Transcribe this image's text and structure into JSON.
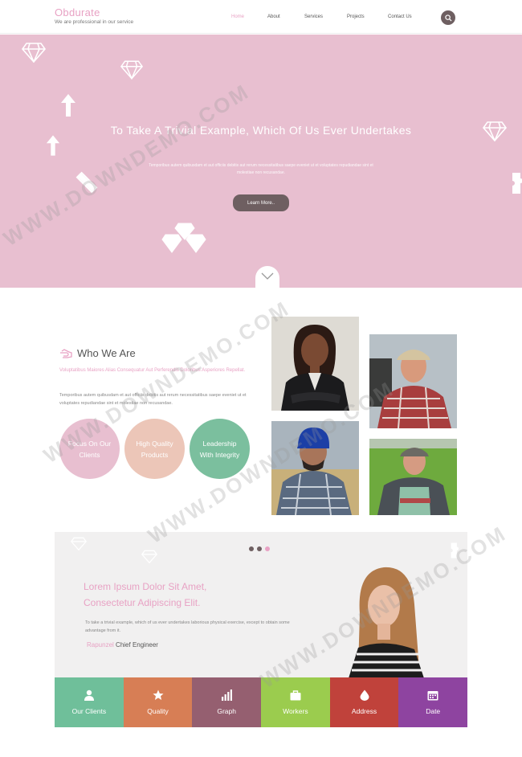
{
  "header": {
    "logo_title": "Obdurate",
    "logo_tagline": "We are professional in our service",
    "nav": [
      "Home",
      "About",
      "Services",
      "Projects",
      "Contact Us"
    ],
    "active_nav": "Home",
    "search_icon": "search-icon"
  },
  "hero": {
    "title": "To Take A Trivial Example, Which Of Us Ever Undertakes",
    "text": "Temporibus autem quibusdam et aut officiis debitis aut rerum necessitatibus saepe eveniet ut et voluptates repudiandae sint et molestiae non recusandae.",
    "button": "Learn More..",
    "icons": [
      "diamond-icon",
      "arrow-up-icon",
      "pencil-ruler-icon",
      "puzzle-icon"
    ]
  },
  "about": {
    "title": "Who We Are",
    "lead": "Voluptatibus Maiores Alias Consequatur Aut Perferendis Doloribus Asperiores Repellat.",
    "text": "Temporibus autem quibusdam et aut officiis debitis aut rerum necessitatibus saepe eveniet ut et voluptates repudiandae sint et molestiae non recusandae.",
    "circles": [
      {
        "label": "Focus On Our Clients",
        "color": "#e8bfd0"
      },
      {
        "label": "High Quality Products",
        "color": "#ecc6b8"
      },
      {
        "label": "Leadership With Integrity",
        "color": "#7bbf9e"
      }
    ]
  },
  "testimonial": {
    "title": "Lorem Ipsum Dolor Sit Amet, Consectetur Adipiscing Elit.",
    "text": "To take a trivial example, which of us ever undertakes laborious physical exercise, except to obtain some advantage from it.",
    "author": "Rapunzel",
    "role": "Chief Engineer",
    "slide_dots": 3,
    "active_dot": 2
  },
  "features": [
    {
      "label": "Our Clients",
      "icon": "user-icon",
      "color": "#6fbf9a"
    },
    {
      "label": "Quality",
      "icon": "star-icon",
      "color": "#d77e55"
    },
    {
      "label": "Graph",
      "icon": "bar-graph-icon",
      "color": "#955f70"
    },
    {
      "label": "Workers",
      "icon": "briefcase-icon",
      "color": "#9bcc4e"
    },
    {
      "label": "Address",
      "icon": "drop-icon",
      "color": "#c0423b"
    },
    {
      "label": "Date",
      "icon": "calendar-icon",
      "color": "#8e44a0"
    }
  ],
  "watermark": "WWW.DOWNDEMO.COM",
  "colors": {
    "pink": "#e8a2c4",
    "hero_bg": "#e8bfd0",
    "dark": "#6e5f61"
  }
}
